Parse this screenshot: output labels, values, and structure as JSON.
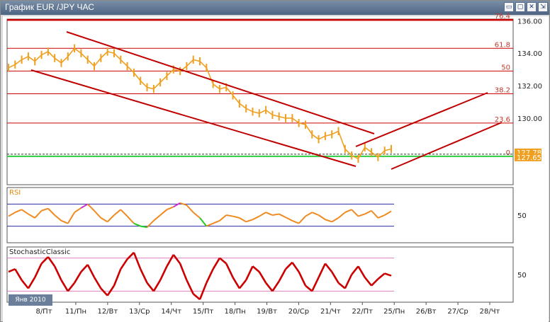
{
  "window": {
    "title": "График EUR /JPY  ЧАС",
    "buttons": {
      "minimize": "▭",
      "restore": "▢",
      "close": "✕",
      "pin": "⇲"
    }
  },
  "period_badge": "Янв 2010",
  "colors": {
    "price": "#f0a020",
    "fib": "#cc0000",
    "trend": "#c00000",
    "support": "#2ecc40",
    "rsi_main": "#f08a20",
    "rsi_low": "#22cc22",
    "rsi_high": "#cc33cc",
    "stoch": "#cc0000",
    "stoch_band": "#e080c0",
    "rsi_band": "#2a2aa8"
  },
  "chart_data": [
    {
      "type": "line",
      "pane": "price",
      "x_tick_labels": [
        "8/Пт",
        "11/Пн",
        "12/Вт",
        "13/Ср",
        "14/Чт",
        "15/Пт",
        "18/Пн",
        "19/Вт",
        "20/Ср",
        "21/Чт",
        "22/Пт",
        "25/Пн",
        "26/Вт",
        "27/Ср",
        "28/Чт"
      ],
      "y_ticks": [
        "136.00",
        "134.00",
        "132.00",
        "130.00"
      ],
      "ylim": [
        125.9,
        136.1
      ],
      "fib_levels": [
        {
          "label": "76.4",
          "value": 136.05
        },
        {
          "label": "61.8",
          "value": 134.3
        },
        {
          "label": "50",
          "value": 132.9
        },
        {
          "label": "38.2",
          "value": 131.5
        },
        {
          "label": "23.6",
          "value": 129.7
        },
        {
          "label": "0",
          "value": 127.65
        }
      ],
      "price_labels": [
        "127.78",
        "127.65"
      ],
      "last_price": 127.78,
      "support_level": 127.65,
      "series_close": [
        133.1,
        133.3,
        133.6,
        133.8,
        133.5,
        133.9,
        134.1,
        133.7,
        133.4,
        133.8,
        134.3,
        134.0,
        133.6,
        133.2,
        133.7,
        134.1,
        134.0,
        133.6,
        133.2,
        132.8,
        132.3,
        131.9,
        131.8,
        132.2,
        132.6,
        133.0,
        132.9,
        133.2,
        133.6,
        133.5,
        133.1,
        132.1,
        131.8,
        131.9,
        131.4,
        130.9,
        130.6,
        130.4,
        130.3,
        130.5,
        130.2,
        130.1,
        130.0,
        130.0,
        129.7,
        129.6,
        129.0,
        128.7,
        128.9,
        129.0,
        129.2,
        128.1,
        127.7,
        127.5,
        128.2,
        127.9,
        127.6,
        128.0,
        128.1
      ]
    },
    {
      "type": "line",
      "pane": "indicator",
      "title": "RSI",
      "y_ticks": [
        "50"
      ],
      "ylim": [
        0,
        100
      ],
      "levels": [
        70,
        30
      ],
      "values": [
        48,
        55,
        60,
        52,
        45,
        58,
        62,
        50,
        40,
        35,
        55,
        63,
        70,
        58,
        45,
        38,
        50,
        60,
        48,
        35,
        30,
        28,
        40,
        50,
        60,
        65,
        72,
        68,
        55,
        45,
        30,
        35,
        40,
        50,
        48,
        45,
        38,
        42,
        48,
        55,
        50,
        52,
        46,
        40,
        35,
        48,
        55,
        50,
        42,
        38,
        45,
        55,
        60,
        48,
        52,
        58,
        45,
        50,
        57
      ]
    },
    {
      "type": "line",
      "pane": "indicator",
      "title": "StochasticClassic",
      "y_ticks": [
        "50"
      ],
      "ylim": [
        0,
        100
      ],
      "levels": [
        80,
        20
      ],
      "values": [
        55,
        60,
        40,
        25,
        45,
        70,
        82,
        65,
        40,
        20,
        35,
        55,
        68,
        45,
        25,
        12,
        30,
        60,
        78,
        90,
        60,
        35,
        20,
        40,
        65,
        86,
        70,
        40,
        15,
        5,
        35,
        60,
        80,
        70,
        45,
        25,
        40,
        65,
        55,
        35,
        20,
        38,
        60,
        72,
        55,
        30,
        20,
        45,
        70,
        55,
        35,
        25,
        50,
        65,
        45,
        30,
        42,
        52,
        48
      ]
    }
  ]
}
